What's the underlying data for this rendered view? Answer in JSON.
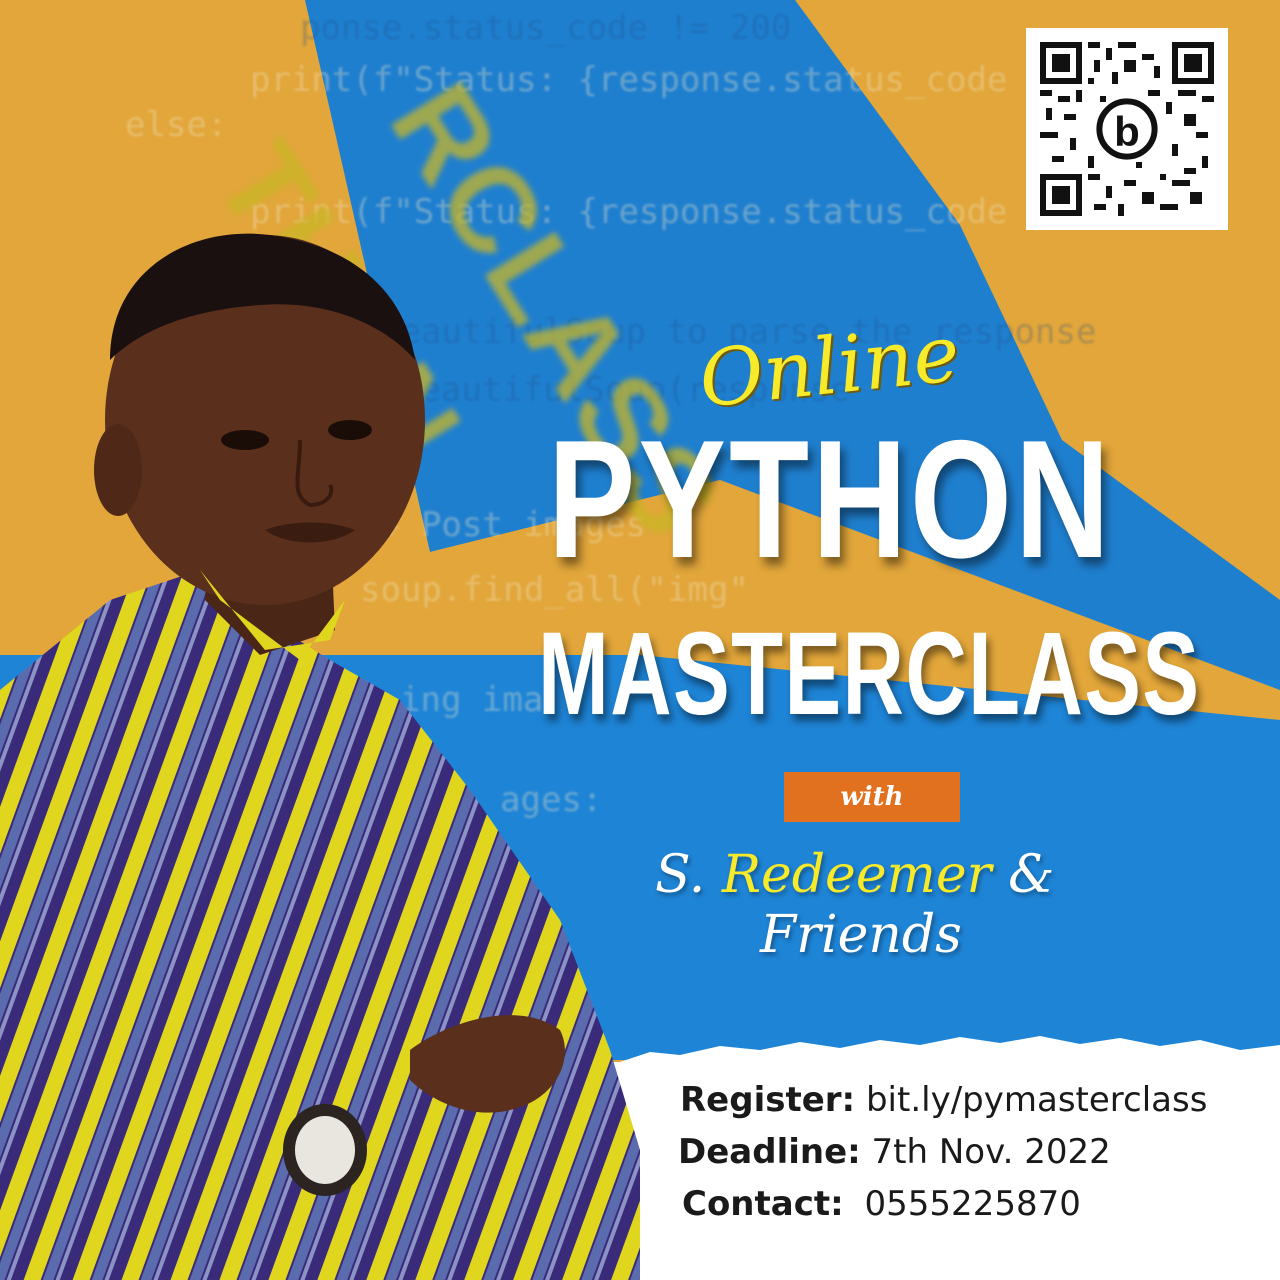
{
  "background": {
    "code_lines": [
      "ponse.status_code != 200",
      "print(f\"Status: {response.status_code",
      "else:",
      "print(f\"Status: {response.status_code",
      "BeautifulSoup to parse the response",
      "BeautifulSoup(response",
      "# Post images",
      "soup.find_all(\"img\"",
      "ing ima",
      "ages:"
    ],
    "blur_word_1": "THON",
    "blur_word_2": "RCLASS",
    "colors": {
      "mustard": "#e2a63a",
      "blue": "#1f7fcf",
      "yellow": "#f7ea2a",
      "orange": "#e2711f"
    }
  },
  "qr": {
    "icon": "qr-code-icon"
  },
  "headline": {
    "script_word": "Online",
    "line1": "PYTHON",
    "line2": "MASTERCLASS"
  },
  "with_label": "with",
  "host": {
    "prefix": "S.",
    "name": "Redeemer",
    "amp": "&",
    "suffix": "Friends"
  },
  "info": {
    "register_label": "Register:",
    "register_value": "bit.ly/pymasterclass",
    "deadline_label": "Deadline:",
    "deadline_value": "7th Nov. 2022",
    "contact_label": "Contact:",
    "contact_value": "0555225870"
  }
}
